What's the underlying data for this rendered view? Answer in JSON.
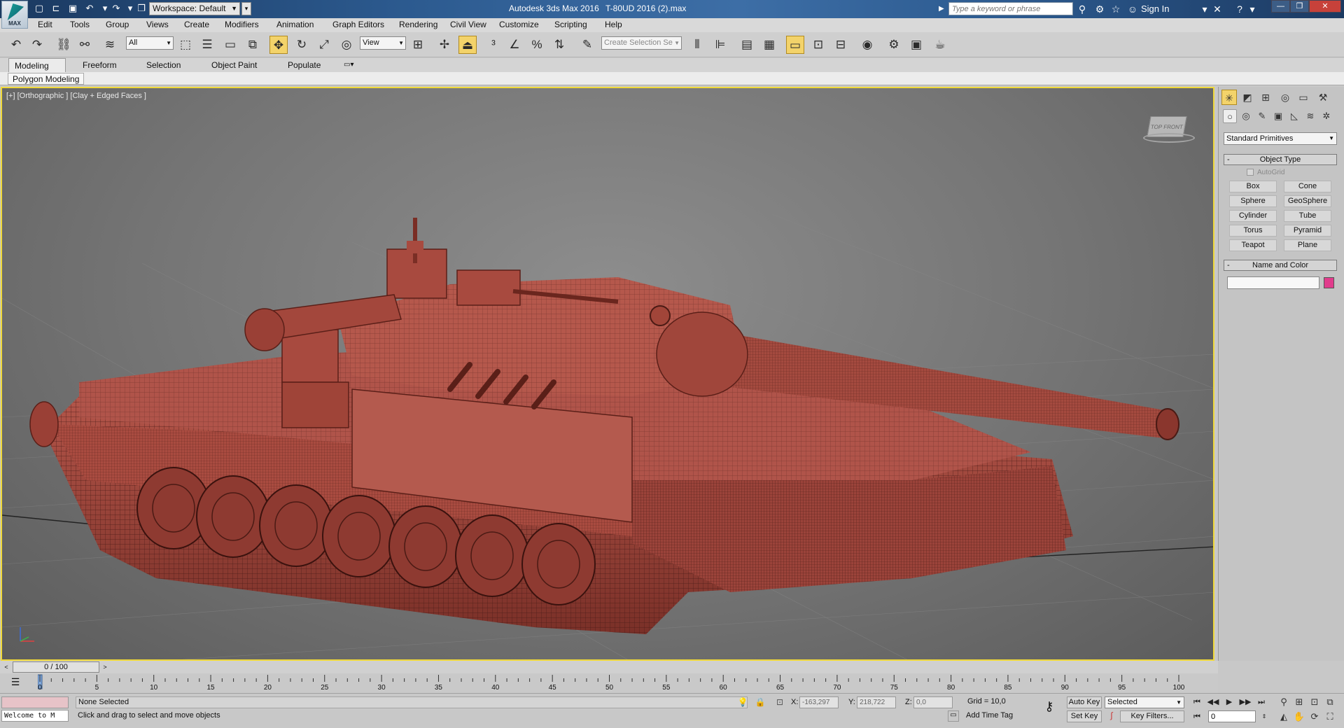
{
  "titlebar": {
    "workspace": "Workspace: Default",
    "app_title": "Autodesk 3ds Max 2016",
    "doc_title": "T-80UD 2016 (2).max",
    "search_placeholder": "Type a keyword or phrase",
    "sign_in": "Sign In",
    "logo_text": "MAX"
  },
  "menu": [
    "Edit",
    "Tools",
    "Group",
    "Views",
    "Create",
    "Modifiers",
    "Animation",
    "Graph Editors",
    "Rendering",
    "Civil View",
    "Customize",
    "Scripting",
    "Help"
  ],
  "toolbar": {
    "selection_filter": "All",
    "ref_coord": "View",
    "selection_set_placeholder": "Create Selection Se"
  },
  "ribbon": {
    "tabs": [
      "Modeling",
      "Freeform",
      "Selection",
      "Object Paint",
      "Populate"
    ],
    "active_tab": "Modeling",
    "panel_label": "Polygon Modeling"
  },
  "viewport": {
    "label": "[+] [Orthographic ] [Clay + Edged Faces ]",
    "viewcube_text": "TOP FRONT",
    "model_color": "#a34a40"
  },
  "command_panel": {
    "primitive_type": "Standard Primitives",
    "object_type_header": "Object Type",
    "autogrid": "AutoGrid",
    "buttons": [
      "Box",
      "Cone",
      "Sphere",
      "GeoSphere",
      "Cylinder",
      "Tube",
      "Torus",
      "Pyramid",
      "Teapot",
      "Plane"
    ],
    "name_color_header": "Name and Color",
    "swatch_color": "#e13c8c"
  },
  "time_slider": {
    "label": "0 / 100"
  },
  "trackbar": {
    "ticks": [
      "0",
      "5",
      "10",
      "15",
      "20",
      "25",
      "30",
      "35",
      "40",
      "45",
      "50",
      "55",
      "60",
      "65",
      "70",
      "75",
      "80",
      "85",
      "90",
      "95",
      "100"
    ]
  },
  "status": {
    "maxscript": "Welcome to M",
    "selection": "None Selected",
    "prompt": "Click and drag to select and move objects",
    "x_label": "X:",
    "x_value": "-163,297",
    "y_label": "Y:",
    "y_value": "218,722",
    "z_label": "Z:",
    "z_value": "0,0",
    "grid": "Grid = 10,0",
    "add_time_tag": "Add Time Tag",
    "auto_key": "Auto Key",
    "set_key": "Set Key",
    "key_mode": "Selected",
    "key_filters": "Key Filters...",
    "frame": "0"
  }
}
